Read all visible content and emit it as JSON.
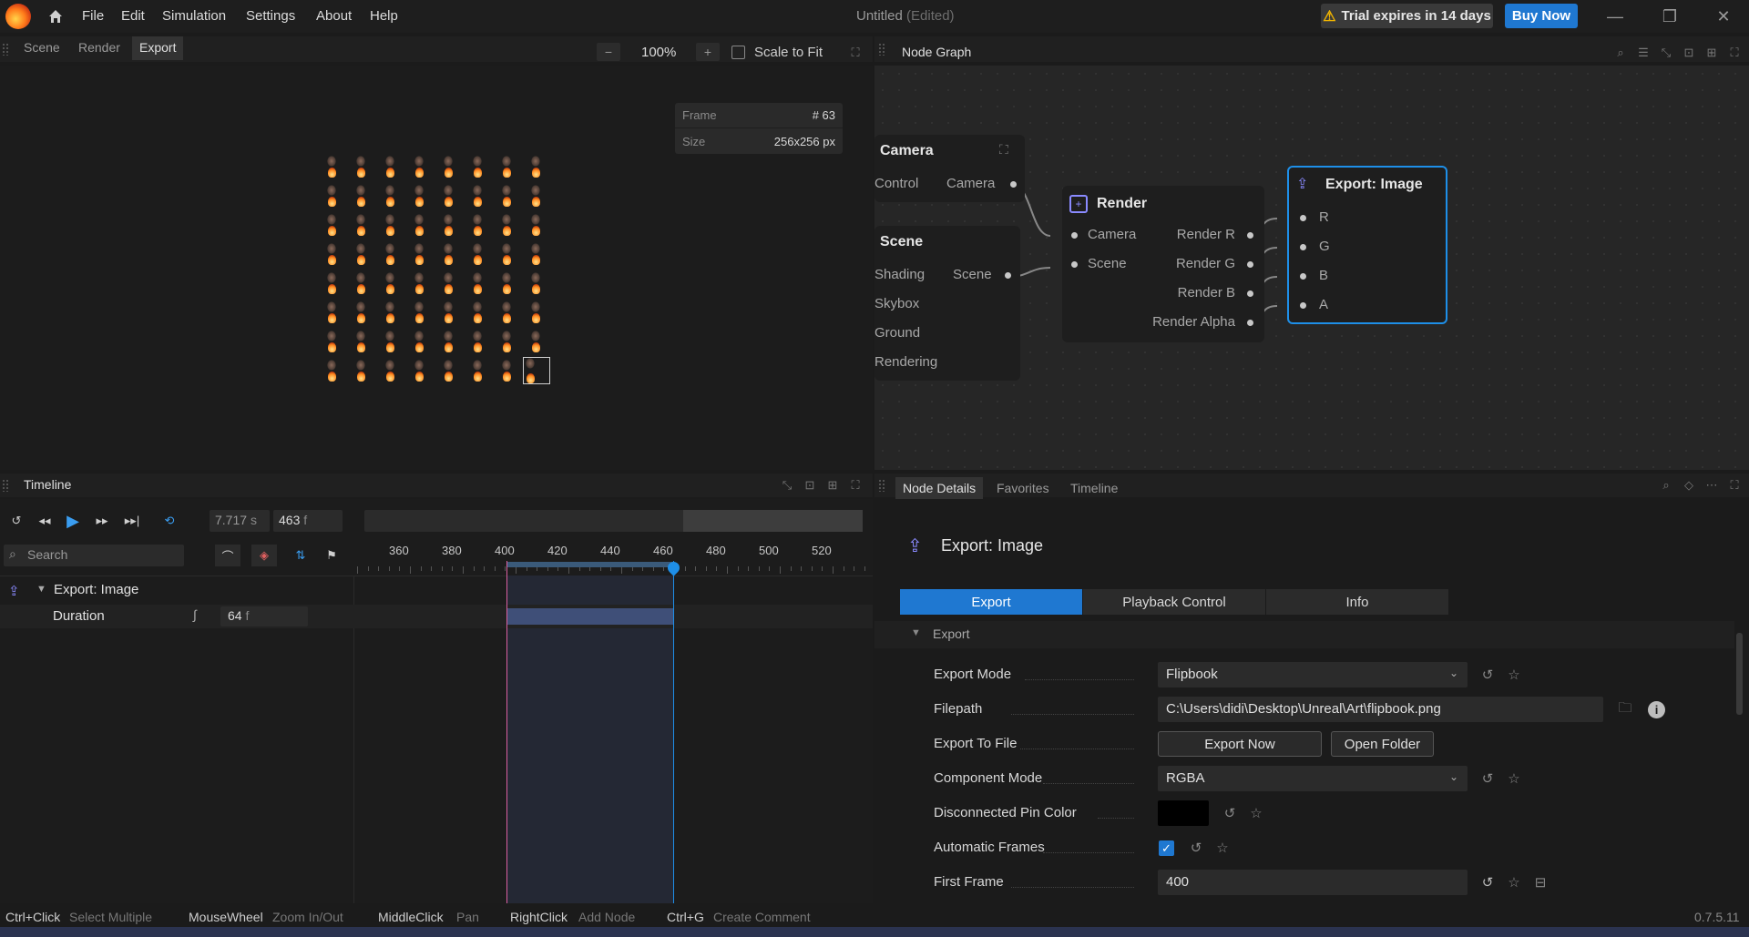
{
  "titlebar": {
    "menu": [
      "File",
      "Edit",
      "Simulation",
      "Settings",
      "About",
      "Help"
    ],
    "doc_title": "Untitled",
    "doc_state": "(Edited)",
    "trial_text": "Trial expires in 14 days",
    "buy_label": "Buy Now"
  },
  "viewport": {
    "tabs": [
      "Scene",
      "Render",
      "Export"
    ],
    "active_tab": "Export",
    "zoom": "100%",
    "zoom_minus": "−",
    "zoom_plus": "+",
    "scale_to_fit": "Scale to Fit",
    "info": {
      "frame_label": "Frame",
      "frame_value": "# 63",
      "size_label": "Size",
      "size_value": "256x256 px"
    },
    "flipbook": {
      "columns": 8,
      "rows": 8,
      "selected_index": 63
    }
  },
  "nodegraph": {
    "title": "Node Graph",
    "nodes": {
      "camera": {
        "title": "Camera",
        "in": "Control",
        "out": "Camera"
      },
      "scene": {
        "title": "Scene",
        "pins": [
          "Shading",
          "Skybox",
          "Ground",
          "Rendering"
        ],
        "out": "Scene"
      },
      "render": {
        "title": "Render",
        "inputs": [
          "Camera",
          "Scene"
        ],
        "outputs": [
          "Render R",
          "Render G",
          "Render B",
          "Render Alpha"
        ]
      },
      "export": {
        "title": "Export: Image",
        "inputs": [
          "R",
          "G",
          "B",
          "A"
        ]
      }
    }
  },
  "timeline": {
    "title": "Timeline",
    "time_value": "7.717",
    "time_unit": "s",
    "frame_value": "463",
    "frame_unit": "f",
    "search_placeholder": "Search",
    "ruler": [
      "360",
      "380",
      "400",
      "420",
      "440",
      "460",
      "480",
      "500",
      "520"
    ],
    "track_title": "Export: Image",
    "param_label": "Duration",
    "param_value": "64",
    "param_unit": "f"
  },
  "details": {
    "tabs": [
      "Node Details",
      "Favorites",
      "Timeline"
    ],
    "active_tab": "Node Details",
    "node_title": "Export: Image",
    "prop_tabs": [
      "Export",
      "Playback Control",
      "Info"
    ],
    "section": "Export",
    "props": {
      "export_mode": {
        "label": "Export Mode",
        "value": "Flipbook"
      },
      "filepath": {
        "label": "Filepath",
        "value": "C:\\Users\\didi\\Desktop\\Unreal\\Art\\flipbook.png"
      },
      "export_to_file": {
        "label": "Export To File",
        "export_now": "Export Now",
        "open_folder": "Open Folder"
      },
      "component_mode": {
        "label": "Component Mode",
        "value": "RGBA"
      },
      "disconnected_pin_color": {
        "label": "Disconnected Pin Color",
        "color": "#000000"
      },
      "automatic_frames": {
        "label": "Automatic Frames",
        "checked": true
      },
      "first_frame": {
        "label": "First Frame",
        "value": "400"
      }
    }
  },
  "statusbar": {
    "hints": [
      {
        "key": "Ctrl+Click",
        "action": "Select Multiple"
      },
      {
        "key": "MouseWheel",
        "action": "Zoom In/Out"
      },
      {
        "key": "MiddleClick",
        "action": "Pan"
      },
      {
        "key": "RightClick",
        "action": "Add Node"
      },
      {
        "key": "Ctrl+G",
        "action": "Create Comment"
      }
    ],
    "version": "0.7.5.11"
  },
  "colors": {
    "accent": "#1f78d1",
    "selection_line": "#1e8fe8",
    "range_start": "#d85fa0",
    "warning": "#f0b400",
    "node_selected": "#1e8fe8"
  }
}
